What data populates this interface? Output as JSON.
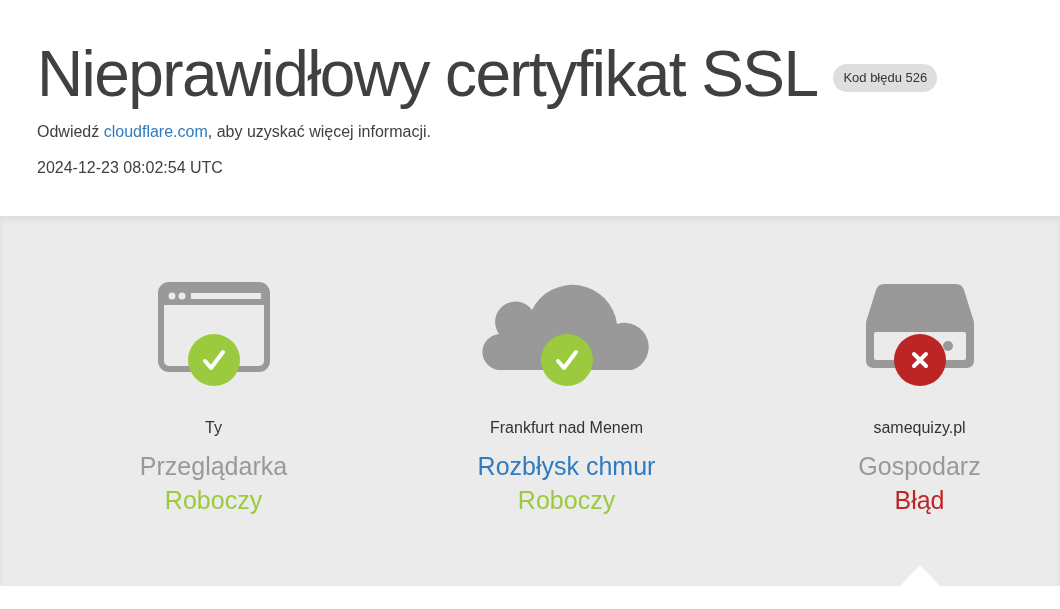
{
  "title": "Nieprawidłowy certyfikat SSL",
  "error_code": "Kod błędu 526",
  "visit": {
    "prefix": "Odwiedź ",
    "link": "cloudflare.com",
    "suffix": ", aby uzyskać więcej informacji."
  },
  "timestamp": "2024-12-23 08:02:54 UTC",
  "nodes": [
    {
      "kind": "browser",
      "name": "Ty",
      "role": "Przeglądarka",
      "role_link": false,
      "failed": false,
      "status_text": "Roboczy",
      "selected": false
    },
    {
      "kind": "cloud",
      "name": "Frankfurt nad Menem",
      "role": "Rozbłysk chmur",
      "role_link": true,
      "failed": false,
      "status_text": "Roboczy",
      "selected": false
    },
    {
      "kind": "server",
      "name": "samequizy.pl",
      "role": "Gospodarz",
      "role_link": false,
      "failed": true,
      "status_text": "Błąd",
      "selected": true
    }
  ]
}
